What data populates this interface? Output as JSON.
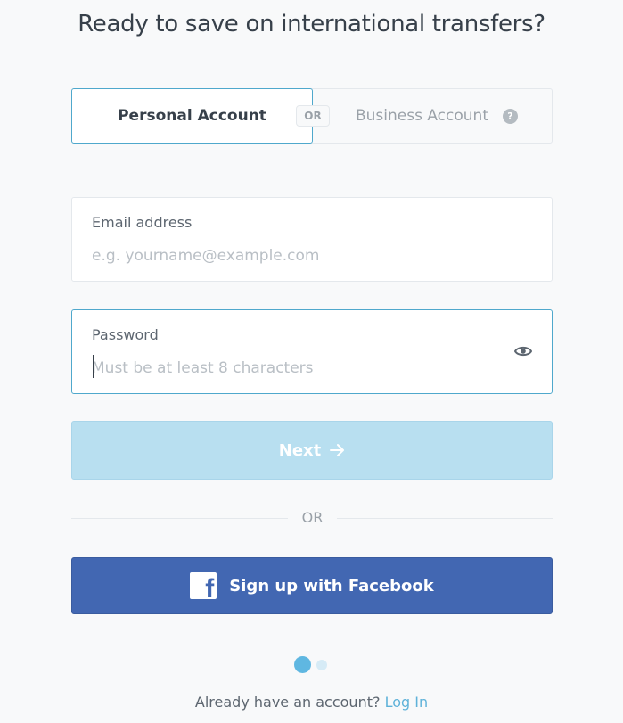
{
  "heading": "Ready to save on international transfers?",
  "account_type": {
    "personal_label": "Personal Account",
    "or_label": "OR",
    "business_label": "Business Account",
    "help_icon_glyph": "?",
    "selected": "personal"
  },
  "email": {
    "label": "Email address",
    "placeholder": "e.g. yourname@example.com",
    "value": ""
  },
  "password": {
    "label": "Password",
    "placeholder": "Must be at least 8 characters",
    "value": "",
    "toggle_icon": "eye-icon"
  },
  "next_button": {
    "label": "Next",
    "icon": "arrow-right-icon"
  },
  "divider": {
    "label": "OR"
  },
  "facebook_button": {
    "label": "Sign up with Facebook",
    "icon": "facebook-icon",
    "icon_glyph": "f"
  },
  "pager": {
    "current": 1,
    "total": 2
  },
  "footer": {
    "prompt": "Already have an account?",
    "link_label": "Log In"
  },
  "colors": {
    "accent": "#5fb7e1",
    "facebook": "#4267b2",
    "next_disabled": "#b8dff0",
    "text": "#37404a"
  }
}
